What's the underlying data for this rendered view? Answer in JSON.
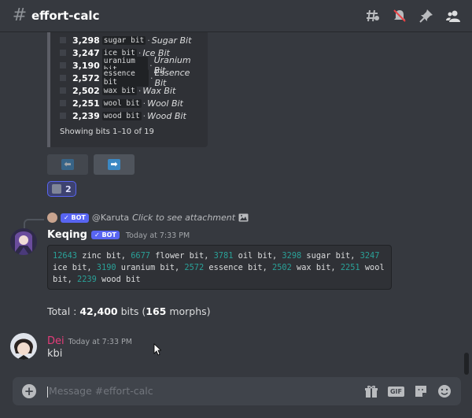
{
  "header": {
    "channel": "effort-calc"
  },
  "embed": {
    "rows": [
      {
        "num": "3,298",
        "code": "sugar bit",
        "name": "Sugar Bit"
      },
      {
        "num": "3,247",
        "code": "ice bit",
        "name": "Ice Bit"
      },
      {
        "num": "3,190",
        "code": "uranium bit",
        "name": "Uranium Bit"
      },
      {
        "num": "2,572",
        "code": "essence bit",
        "name": "Essence Bit"
      },
      {
        "num": "2,502",
        "code": "wax bit",
        "name": "Wax Bit"
      },
      {
        "num": "2,251",
        "code": "wool bit",
        "name": "Wool Bit"
      },
      {
        "num": "2,239",
        "code": "wood bit",
        "name": "Wood Bit"
      }
    ],
    "footer": "Showing bits 1–10 of 19",
    "sep": "·"
  },
  "reaction": {
    "count": "2"
  },
  "reply": {
    "bot_tag": "✓ BOT",
    "name": "@Karuta",
    "text": "Click to see attachment"
  },
  "keqing_msg": {
    "username": "Keqing",
    "bot_tag": "✓ BOT",
    "timestamp": "Today at 7:33 PM",
    "items": [
      {
        "num": "12643",
        "label": " zinc bit, "
      },
      {
        "num": "6677",
        "label": " flower bit, "
      },
      {
        "num": "3781",
        "label": " oil bit, "
      },
      {
        "num": "3298",
        "label": " sugar bit, "
      },
      {
        "num": "3247",
        "label": " ice bit, "
      },
      {
        "num": "3190",
        "label": " uranium bit, "
      },
      {
        "num": "2572",
        "label": " essence bit, "
      },
      {
        "num": "2502",
        "label": " wax bit, "
      },
      {
        "num": "2251",
        "label": " wool bit, "
      },
      {
        "num": "2239",
        "label": " wood bit"
      }
    ],
    "total_prefix": "Total : ",
    "total_bits": "42,400",
    "total_mid": " bits (",
    "total_morphs": "165",
    "total_suffix": " morphs)"
  },
  "dei_msg": {
    "username": "Dei",
    "timestamp": "Today at 7:33 PM",
    "text": "kbi"
  },
  "input": {
    "placeholder": "Message #effort-calc",
    "gif_label": "GIF"
  },
  "colors": {
    "accent": "#5865f2",
    "code_number": "#2aa198",
    "dei_name": "#e63c7a"
  }
}
